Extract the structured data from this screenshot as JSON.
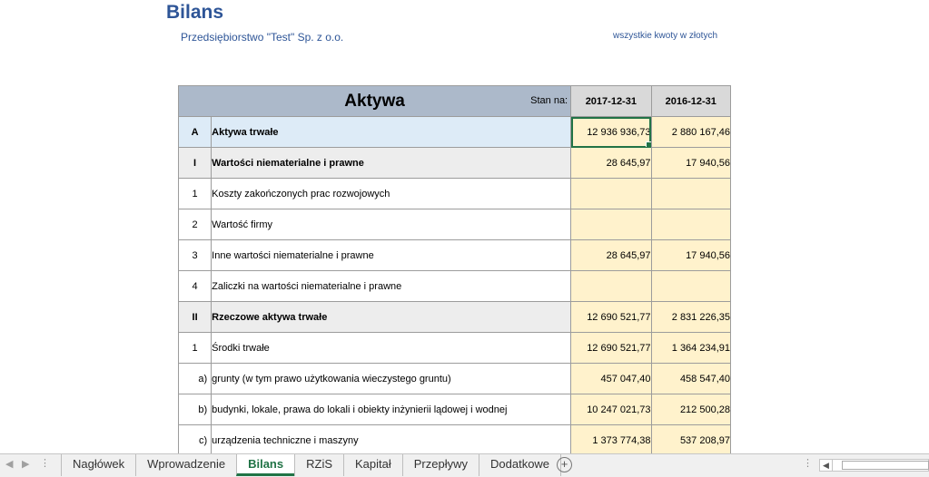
{
  "header": {
    "title": "Bilans",
    "company": "Przedsiębiorstwo \"Test\" Sp. z o.o.",
    "amounts_note": "wszystkie kwoty w złotych"
  },
  "table": {
    "title": "Aktywa",
    "stan_label": "Stan na:",
    "date1": "2017-12-31",
    "date2": "2016-12-31",
    "rows": [
      {
        "idx": "A",
        "desc": "Aktywa trwałe",
        "v1": "12 936 936,73",
        "v2": "2 880 167,46"
      },
      {
        "idx": "I",
        "desc": "Wartości niematerialne i prawne",
        "v1": "28 645,97",
        "v2": "17 940,56"
      },
      {
        "idx": "1",
        "desc": "Koszty zakończonych prac rozwojowych",
        "v1": "",
        "v2": ""
      },
      {
        "idx": "2",
        "desc": "Wartość firmy",
        "v1": "",
        "v2": ""
      },
      {
        "idx": "3",
        "desc": "Inne wartości niematerialne i prawne",
        "v1": "28 645,97",
        "v2": "17 940,56"
      },
      {
        "idx": "4",
        "desc": "Zaliczki na wartości niematerialne i prawne",
        "v1": "",
        "v2": ""
      },
      {
        "idx": "II",
        "desc": "Rzeczowe aktywa trwałe",
        "v1": "12 690 521,77",
        "v2": "2 831 226,35"
      },
      {
        "idx": "1",
        "desc": "Środki trwałe",
        "v1": "12 690 521,77",
        "v2": "1 364 234,91"
      },
      {
        "idx": "a)",
        "desc": "grunty (w tym prawo użytkowania wieczystego gruntu)",
        "v1": "457 047,40",
        "v2": "458 547,40"
      },
      {
        "idx": "b)",
        "desc": "budynki, lokale, prawa do lokali i obiekty inżynierii lądowej i wodnej",
        "v1": "10 247 021,73",
        "v2": "212 500,28"
      },
      {
        "idx": "c)",
        "desc": "urządzenia techniczne i maszyny",
        "v1": "1 373 774,38",
        "v2": "537 208,97"
      }
    ]
  },
  "tabs": [
    "Nagłówek",
    "Wprowadzenie",
    "Bilans",
    "RZiS",
    "Kapitał",
    "Przepływy",
    "Dodatkowe"
  ],
  "active_tab": "Bilans",
  "colors": {
    "title_blue": "#2e5597",
    "header_fill": "#acb9ca",
    "input_fill": "#fff2cc",
    "level_a_fill": "#ddebf7",
    "level_b_fill": "#ededed",
    "active_tab": "#217346"
  },
  "icons": {
    "add_sheet": "plus-circle-icon",
    "prev_sheet": "chevron-left-icon",
    "next_sheet": "chevron-right-icon"
  }
}
